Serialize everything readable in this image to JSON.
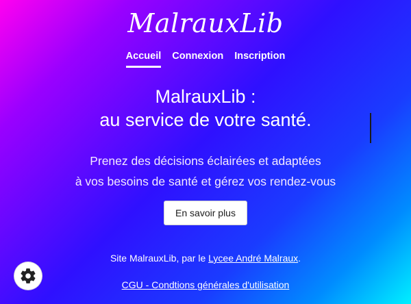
{
  "brand": {
    "title": "MalrauxLib"
  },
  "nav": {
    "items": [
      {
        "label": "Accueil",
        "active": true
      },
      {
        "label": "Connexion",
        "active": false
      },
      {
        "label": "Inscription",
        "active": false
      }
    ]
  },
  "hero": {
    "title_line1": "MalrauxLib :",
    "title_line2": "au service de votre santé.",
    "subtitle_line1": "Prenez des décisions éclairées et adaptées",
    "subtitle_line2": "à vos besoins de santé et gérez vos rendez-vous",
    "cta_label": "En savoir plus"
  },
  "footer": {
    "site_prefix": "Site MalrauxLib, par le ",
    "school_link": "Lycee André Malraux",
    "site_suffix": ".",
    "cgu_link": "CGU - Condtions générales d'utilisation"
  },
  "icons": {
    "settings": "gear-icon"
  }
}
